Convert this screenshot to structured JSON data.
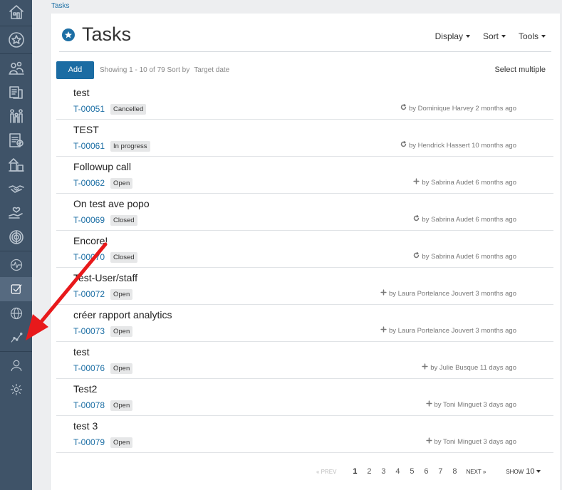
{
  "breadcrumb": "Tasks",
  "header": {
    "title": "Tasks",
    "menus": [
      "Display",
      "Sort",
      "Tools"
    ]
  },
  "toolbar": {
    "add_label": "Add",
    "showing": "Showing 1 - 10 of 79",
    "sort_by": "Sort by",
    "sort_value": "Target date",
    "select_multiple": "Select multiple"
  },
  "sidebar": {
    "items": [
      "home-icon",
      "star-icon",
      "people-icon",
      "documents-icon",
      "family-icon",
      "checklist-document-icon",
      "buildings-icon",
      "handshake-icon",
      "hand-heart-icon",
      "fingerprint-icon",
      "activity-icon",
      "tasks-check-icon",
      "globe-icon",
      "chart-line-icon",
      "user-icon",
      "gear-icon"
    ],
    "active_index": 11
  },
  "tasks": [
    {
      "title": "test",
      "id": "T-00051",
      "status": "Cancelled",
      "meta": "by Dominique Harvey 2 months ago",
      "meta_icon": "refresh-icon"
    },
    {
      "title": "TEST",
      "id": "T-00061",
      "status": "In progress",
      "meta": "by Hendrick Hassert 10 months ago",
      "meta_icon": "refresh-icon"
    },
    {
      "title": "Followup call",
      "id": "T-00062",
      "status": "Open",
      "meta": "by Sabrina Audet 6 months ago",
      "meta_icon": "plus-icon"
    },
    {
      "title": "On test ave popo",
      "id": "T-00069",
      "status": "Closed",
      "meta": "by Sabrina Audet 6 months ago",
      "meta_icon": "refresh-icon"
    },
    {
      "title": "Encore!",
      "id": "T-00070",
      "status": "Closed",
      "meta": "by Sabrina Audet 6 months ago",
      "meta_icon": "refresh-icon"
    },
    {
      "title": "Test-User/staff",
      "id": "T-00072",
      "status": "Open",
      "meta": "by Laura Portelance Jouvert 3 months ago",
      "meta_icon": "plus-icon"
    },
    {
      "title": "créer rapport analytics",
      "id": "T-00073",
      "status": "Open",
      "meta": "by Laura Portelance Jouvert 3 months ago",
      "meta_icon": "plus-icon"
    },
    {
      "title": "test",
      "id": "T-00076",
      "status": "Open",
      "meta": "by Julie Busque 11 days ago",
      "meta_icon": "plus-icon"
    },
    {
      "title": "Test2",
      "id": "T-00078",
      "status": "Open",
      "meta": "by Toni Minguet 3 days ago",
      "meta_icon": "plus-icon"
    },
    {
      "title": "test 3",
      "id": "T-00079",
      "status": "Open",
      "meta": "by Toni Minguet 3 days ago",
      "meta_icon": "plus-icon"
    }
  ],
  "pagination": {
    "prev": "« PREV",
    "pages": [
      "1",
      "2",
      "3",
      "4",
      "5",
      "6",
      "7",
      "8"
    ],
    "current": "1",
    "next": "NEXT »",
    "show_label": "SHOW",
    "show_value": "10"
  },
  "colors": {
    "accent": "#1b6ca3",
    "sidebar": "#3f5368",
    "annotation": "#e8191b"
  }
}
